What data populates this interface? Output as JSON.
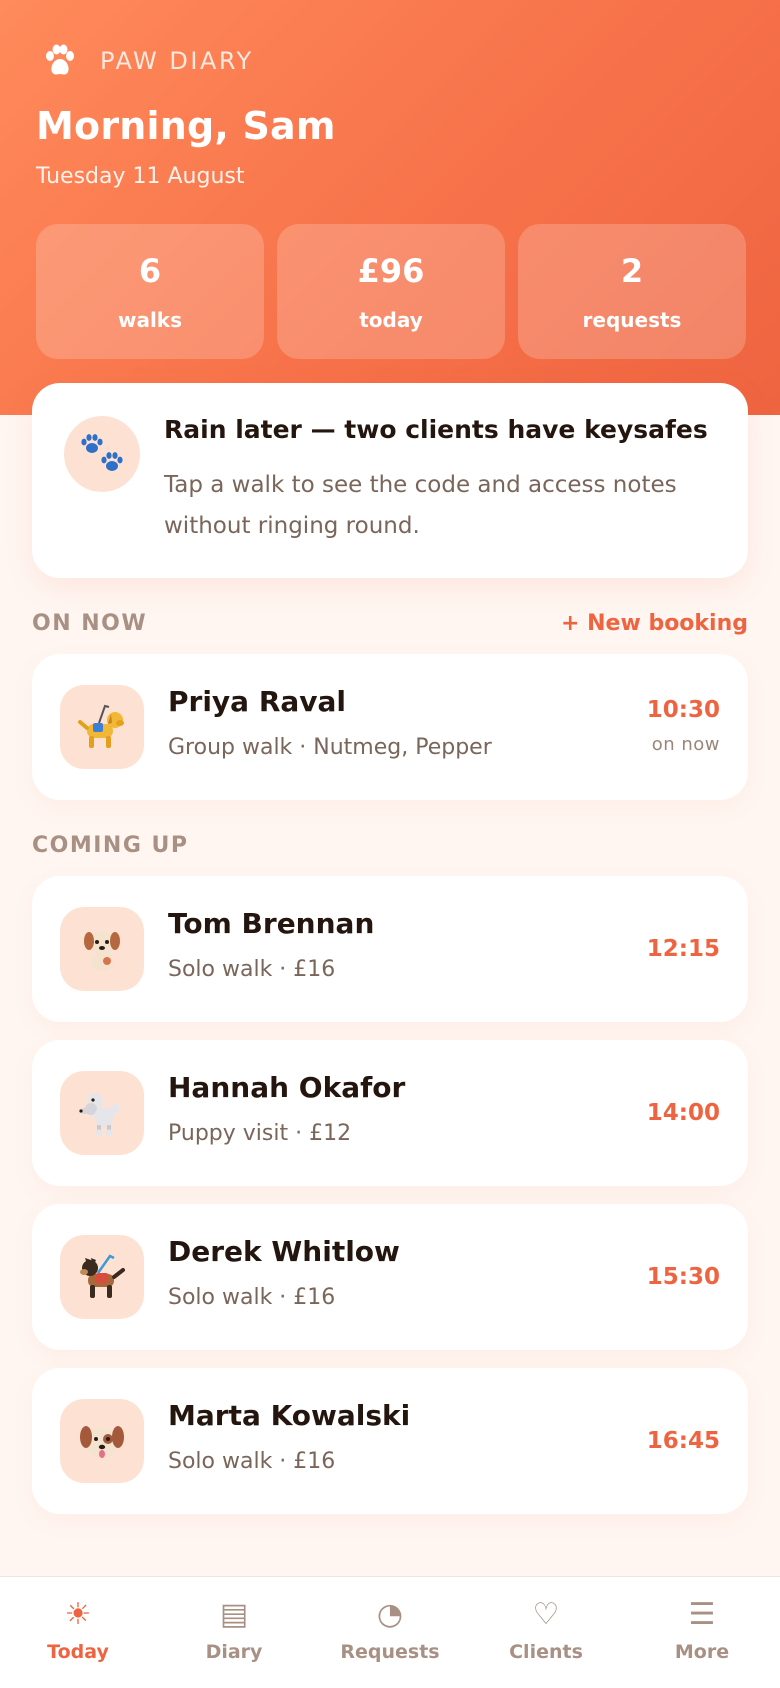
{
  "colors": {
    "accent": "#ee6440",
    "header_start": "#ff8a5a",
    "header_end": "#ee6440",
    "background": "#fff6f1",
    "avatar_bg": "#fde2d4"
  },
  "brand": {
    "name": "PAW DIARY",
    "icon": "paw-icon"
  },
  "header": {
    "greeting": "Morning, Sam",
    "date": "Tuesday 11 August"
  },
  "stats": [
    {
      "value": "6",
      "label": "walks"
    },
    {
      "value": "£96",
      "label": "today"
    },
    {
      "value": "2",
      "label": "requests"
    }
  ],
  "notice": {
    "icon": "paw-prints-icon",
    "title": "Rain later — two clients have keysafes",
    "body": "Tap a walk to see the code and access notes without ringing round."
  },
  "on_now": {
    "title": "ON NOW",
    "new_booking": "+ New booking",
    "walk": {
      "name": "Priya Raval",
      "detail": "Group walk · Nutmeg, Pepper",
      "time": "10:30",
      "note": "on now",
      "icon": "guide-dog-icon"
    }
  },
  "coming_up": {
    "title": "COMING UP",
    "walks": [
      {
        "name": "Tom Brennan",
        "detail": "Solo walk · £16",
        "time": "12:15",
        "icon": "dog-icon"
      },
      {
        "name": "Hannah Okafor",
        "detail": "Puppy visit · £12",
        "time": "14:00",
        "icon": "poodle-icon"
      },
      {
        "name": "Derek Whitlow",
        "detail": "Solo walk · £16",
        "time": "15:30",
        "icon": "service-dog-icon"
      },
      {
        "name": "Marta Kowalski",
        "detail": "Solo walk · £16",
        "time": "16:45",
        "icon": "dog-face-icon"
      }
    ]
  },
  "nav": [
    {
      "label": "Today",
      "glyph": "☀",
      "icon": "sun-icon",
      "active": true
    },
    {
      "label": "Diary",
      "glyph": "▤",
      "icon": "diary-icon",
      "active": false
    },
    {
      "label": "Requests",
      "glyph": "◔",
      "icon": "requests-icon",
      "active": false
    },
    {
      "label": "Clients",
      "glyph": "♡",
      "icon": "heart-icon",
      "active": false
    },
    {
      "label": "More",
      "glyph": "☰",
      "icon": "menu-icon",
      "active": false
    }
  ]
}
